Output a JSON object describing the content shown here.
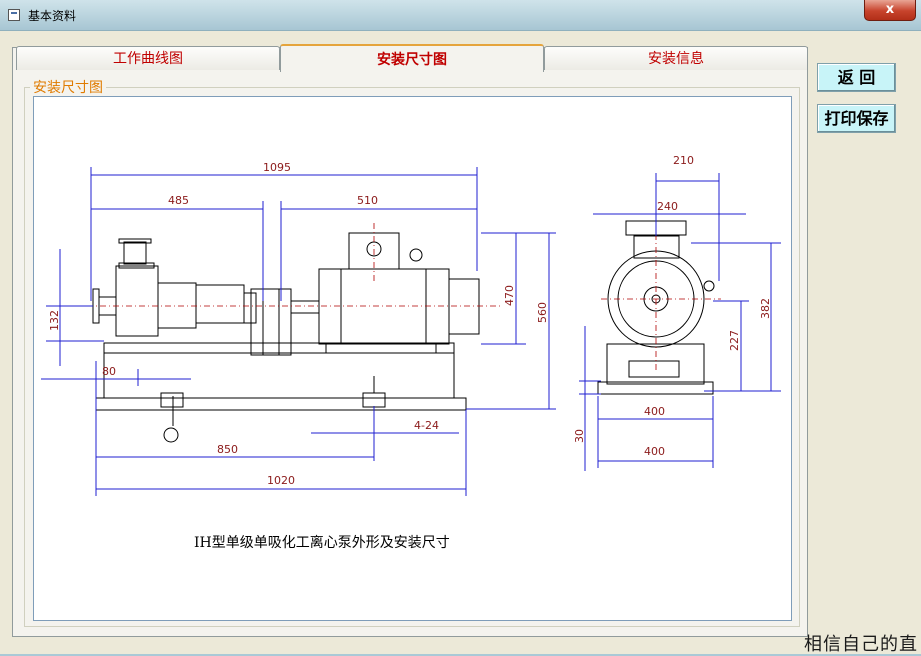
{
  "window": {
    "title": "基本资料",
    "close_glyph": "x"
  },
  "tabs": [
    {
      "label": "工作曲线图",
      "active": false
    },
    {
      "label": "安装尺寸图",
      "active": true
    },
    {
      "label": "安装信息",
      "active": false
    }
  ],
  "group": {
    "label": "安装尺寸图"
  },
  "buttons": {
    "back": "返 回",
    "print_save": "打印保存"
  },
  "drawing": {
    "caption": "IH型单级单吸化工离心泵外形及安装尺寸",
    "dimensions": {
      "overall_length": "1095",
      "pump_length": "485",
      "motor_length": "510",
      "motor_height": "470",
      "total_height": "560",
      "inlet_height": "132",
      "base_offset": "80",
      "bolt_spacing": "850",
      "base_length": "1020",
      "bolt_holes": "4-24",
      "motor_width": "210",
      "junction_width": "240",
      "shaft_height": "227",
      "top_height": "382",
      "base_width_top": "400",
      "base_width_bottom": "400",
      "base_thickness": "30"
    }
  },
  "watermark": "相信自己的直"
}
